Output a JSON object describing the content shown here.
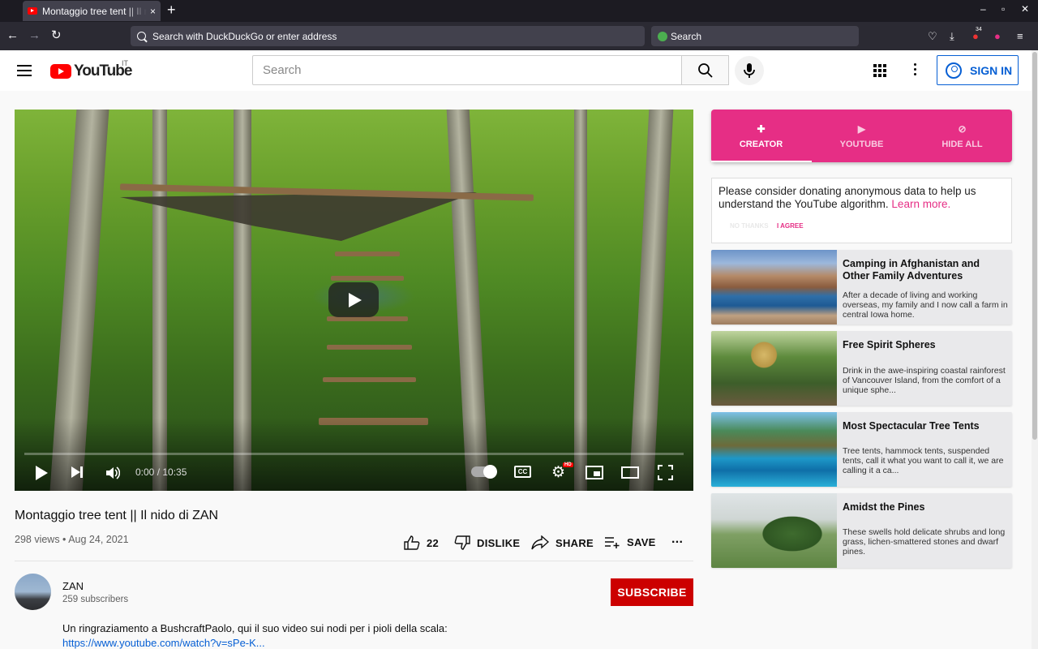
{
  "browser": {
    "tab_title": "Montaggio tree tent || Il nido di ZAN",
    "tab_close": "×",
    "new_tab": "+",
    "url_placeholder": "Search with DuckDuckGo or enter address",
    "search_placeholder": "Search",
    "extension_badge": "34"
  },
  "youtube": {
    "logo_text": "YouTube",
    "country_code": "IT",
    "search_placeholder": "Search",
    "sign_in_label": "SIGN IN"
  },
  "player": {
    "time": "0:00 / 10:35",
    "cc_label": "CC",
    "hd_label": "HD",
    "progress": 0
  },
  "video": {
    "title": "Montaggio tree tent || Il nido di ZAN",
    "meta": "298 views • Aug 24, 2021",
    "like_count": "22",
    "dislike_label": "DISLIKE",
    "share_label": "SHARE",
    "save_label": "SAVE",
    "more": "..."
  },
  "channel": {
    "name": "ZAN",
    "subscribers": "259 subscribers",
    "subscribe_label": "SUBSCRIBE",
    "description": "Un ringraziamento a BushcraftPaolo, qui il suo video sui nodi per i pioli della scala:",
    "description_link": "https://www.youtube.com/watch?v=sPe-K..."
  },
  "extension": {
    "tabs": [
      {
        "label": "CREATOR",
        "icon": "creator-icon"
      },
      {
        "label": "YOUTUBE",
        "icon": "youtube-icon"
      },
      {
        "label": "HIDE ALL",
        "icon": "eye-off-icon"
      }
    ],
    "consent_text": "Please consider donating anonymous data to help us understand the YouTube algorithm.",
    "consent_link": "Learn more.",
    "disagree_label": "NO THANKS",
    "agree_label": "I AGREE",
    "accent_color": "#e62e85",
    "cards": [
      {
        "title": "Camping in Afghanistan and Other Family Adventures",
        "desc": "After a decade of living and working overseas, my family and I now call a farm in central Iowa home."
      },
      {
        "title": "Free Spirit Spheres",
        "desc": "Drink in the awe-inspiring coastal rainforest of Vancouver Island, from the comfort of a unique sphe..."
      },
      {
        "title": "Most Spectacular Tree Tents",
        "desc": "Tree tents, hammock tents, suspended tents, call it what you want to call it, we are calling it a ca..."
      },
      {
        "title": "Amidst the Pines",
        "desc": "These swells hold delicate shrubs and long grass, lichen-smattered stones and dwarf pines."
      }
    ]
  }
}
